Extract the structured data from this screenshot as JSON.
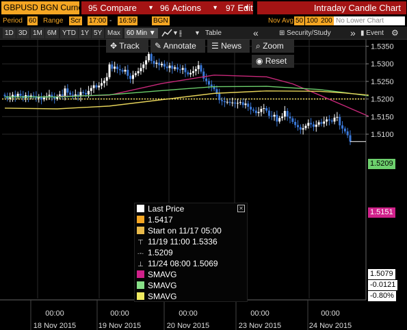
{
  "header": {
    "ticker": "GBPUSD BGN Curncy",
    "compare": {
      "num": "95",
      "label": "Compare"
    },
    "actions": {
      "num": "96",
      "label": "Actions"
    },
    "edit": {
      "num": "97",
      "label": "Edit"
    },
    "chart_title": "Intraday Candle Chart"
  },
  "period_bar": {
    "period_label": "Period",
    "period_value": "60",
    "range_label": "Range",
    "range_from": "Scr",
    "start_time": "17:00",
    "sep": "-",
    "end_time": "16:59",
    "source": "BGN",
    "date_right": "Nov Avg",
    "sma_periods": [
      "50",
      "100",
      "200"
    ],
    "lower_chart": "No Lower Chart"
  },
  "toolbar": {
    "ranges": [
      "1D",
      "3D",
      "1M",
      "6M",
      "YTD",
      "1Y",
      "5Y",
      "Max"
    ],
    "interval": "60 Min",
    "table_label": "Table",
    "security_study": "Security/Study",
    "event": "Event"
  },
  "overlay": {
    "track": "Track",
    "annotate": "Annotate",
    "news": "News",
    "zoom": "Zoom",
    "reset": "Reset"
  },
  "legend": {
    "last_price": "Last Price",
    "open_value": "1.5417",
    "start": "Start on 11/17 05:00",
    "high": "11/19 11:00 1.5336",
    "mid": "1.5209",
    "low": "11/24 08:00 1.5069",
    "sma1": "SMAVG",
    "sma2": "SMAVG",
    "sma3": "SMAVG"
  },
  "price_tags": {
    "sma_green": "1.5209",
    "sma_magenta": "1.5151",
    "last": "1.5079",
    "change": "-0.0121",
    "change_pct": "-0.80%"
  },
  "colors": {
    "orange": "#f5a623",
    "red_button": "#a41414",
    "candle_up": "#ffffff",
    "candle_down": "#3a78d8",
    "sma_magenta": "#c8287a",
    "sma_green": "#6dd06d",
    "sma_yellow": "#e6d35a",
    "reference_line": "#e6d35a"
  },
  "chart_data": {
    "type": "candlestick",
    "title": "",
    "ylim": [
      1.505,
      1.5365
    ],
    "y_ticks": [
      "1.5350",
      "1.5300",
      "1.5250",
      "1.5200",
      "1.5150",
      "1.5100"
    ],
    "reference_level": 1.52,
    "x_tick_labels": [
      {
        "time": "00:00",
        "date": "18 Nov 2015"
      },
      {
        "time": "00:00",
        "date": "19 Nov 2015"
      },
      {
        "time": "00:00",
        "date": "20 Nov 2015"
      },
      {
        "time": "00:00",
        "date": "23 Nov 2015"
      },
      {
        "time": "00:00",
        "date": "24 Nov 2015"
      }
    ],
    "close": [
      1.5208,
      1.5201,
      1.5204,
      1.5212,
      1.5206,
      1.5215,
      1.5209,
      1.5203,
      1.5211,
      1.5205,
      1.521,
      1.5208,
      1.5202,
      1.5206,
      1.5199,
      1.5204,
      1.5208,
      1.5212,
      1.5206,
      1.5201,
      1.5207,
      1.5213,
      1.5208,
      1.523,
      1.5218,
      1.5212,
      1.5208,
      1.5213,
      1.5207,
      1.522,
      1.5217,
      1.5213,
      1.5223,
      1.5231,
      1.5239,
      1.5233,
      1.5238,
      1.5245,
      1.5252,
      1.5262,
      1.5298,
      1.5286,
      1.5292,
      1.5285,
      1.5282,
      1.5278,
      1.5283,
      1.5266,
      1.5257,
      1.5268,
      1.5273,
      1.5279,
      1.5288,
      1.5298,
      1.531,
      1.5328,
      1.5308,
      1.53,
      1.5303,
      1.5296,
      1.53,
      1.5292,
      1.5288,
      1.5295,
      1.5286,
      1.529,
      1.5284,
      1.5283,
      1.5288,
      1.5276,
      1.527,
      1.5274,
      1.5279,
      1.5285,
      1.5296,
      1.5278,
      1.5258,
      1.5251,
      1.5241,
      1.5236,
      1.5228,
      1.5215,
      1.5197,
      1.5194,
      1.5191,
      1.5192,
      1.5189,
      1.519,
      1.5187,
      1.5189,
      1.5191,
      1.5183,
      1.5187,
      1.5178,
      1.517,
      1.5167,
      1.516,
      1.5163,
      1.5172,
      1.5174,
      1.5167,
      1.5152,
      1.515,
      1.5155,
      1.5136,
      1.5146,
      1.515,
      1.5166,
      1.515,
      1.5145,
      1.5135,
      1.5126,
      1.512,
      1.5113,
      1.5117,
      1.5124,
      1.5132,
      1.5128,
      1.5121,
      1.5127,
      1.5134,
      1.513,
      1.5136,
      1.5142,
      1.5139,
      1.5136,
      1.5147,
      1.5149,
      1.5125,
      1.5116,
      1.5108,
      1.5097,
      1.5079
    ],
    "series": [
      {
        "name": "SMAVG",
        "color": "#c8287a",
        "x_index": [
          20,
          40,
          60,
          80,
          100,
          110,
          120,
          130,
          139
        ],
        "values": [
          1.5207,
          1.5211,
          1.5244,
          1.5268,
          1.5263,
          1.5243,
          1.5212,
          1.518,
          1.5151
        ]
      },
      {
        "name": "SMAVG",
        "color": "#6dd06d",
        "x_index": [
          0,
          20,
          40,
          60,
          80,
          100,
          120,
          130,
          139
        ],
        "values": [
          1.5206,
          1.5206,
          1.5212,
          1.5224,
          1.5235,
          1.5236,
          1.5227,
          1.5218,
          1.5209
        ]
      },
      {
        "name": "SMAVG",
        "color": "#e6d35a",
        "x_index": [
          0,
          20,
          40,
          60,
          80,
          100,
          120,
          130,
          139
        ],
        "values": [
          1.5174,
          1.5172,
          1.518,
          1.5198,
          1.5216,
          1.5223,
          1.5222,
          1.5217,
          1.5211
        ]
      }
    ]
  }
}
